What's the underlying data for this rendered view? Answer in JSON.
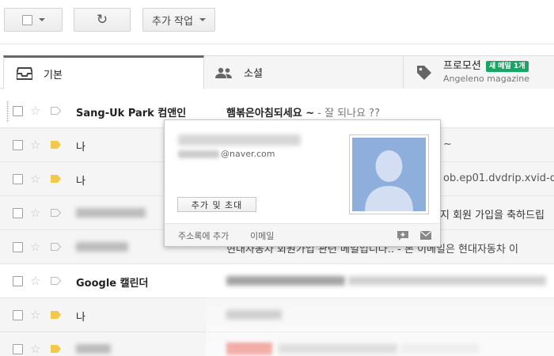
{
  "toolbar": {
    "more_actions_label": "추가 작업"
  },
  "tabs": [
    {
      "label": "기본"
    },
    {
      "label": "소셜"
    },
    {
      "label": "프로모션",
      "badge": "새 메일 1개",
      "subtitle": "Angeleno magazine"
    }
  ],
  "emails": [
    {
      "sender": "Sang-Uk Park 컴앤인",
      "subject": "햄볶은아침되세요 ~",
      "snippet": " - 잘 되나요 ??"
    },
    {
      "sender": "나",
      "snippet_tail": "~"
    },
    {
      "sender": "나",
      "snippet_tail": "ob.ep01.dvdrip.xvid-de"
    },
    {
      "snippet_tail": "지 회원 가입을 축하드립"
    },
    {
      "snippet": "현대자동차 회원가입 관련 메일입니다.. - 본 이메일은 현대자동차 이"
    },
    {
      "sender": "Google 캘린더"
    },
    {
      "sender": "나"
    },
    {}
  ],
  "hovercard": {
    "email_domain": "@naver.com",
    "add_invite_label": "추가 및 초대",
    "add_contacts_label": "주소록에 추가",
    "email_label": "이메일"
  }
}
